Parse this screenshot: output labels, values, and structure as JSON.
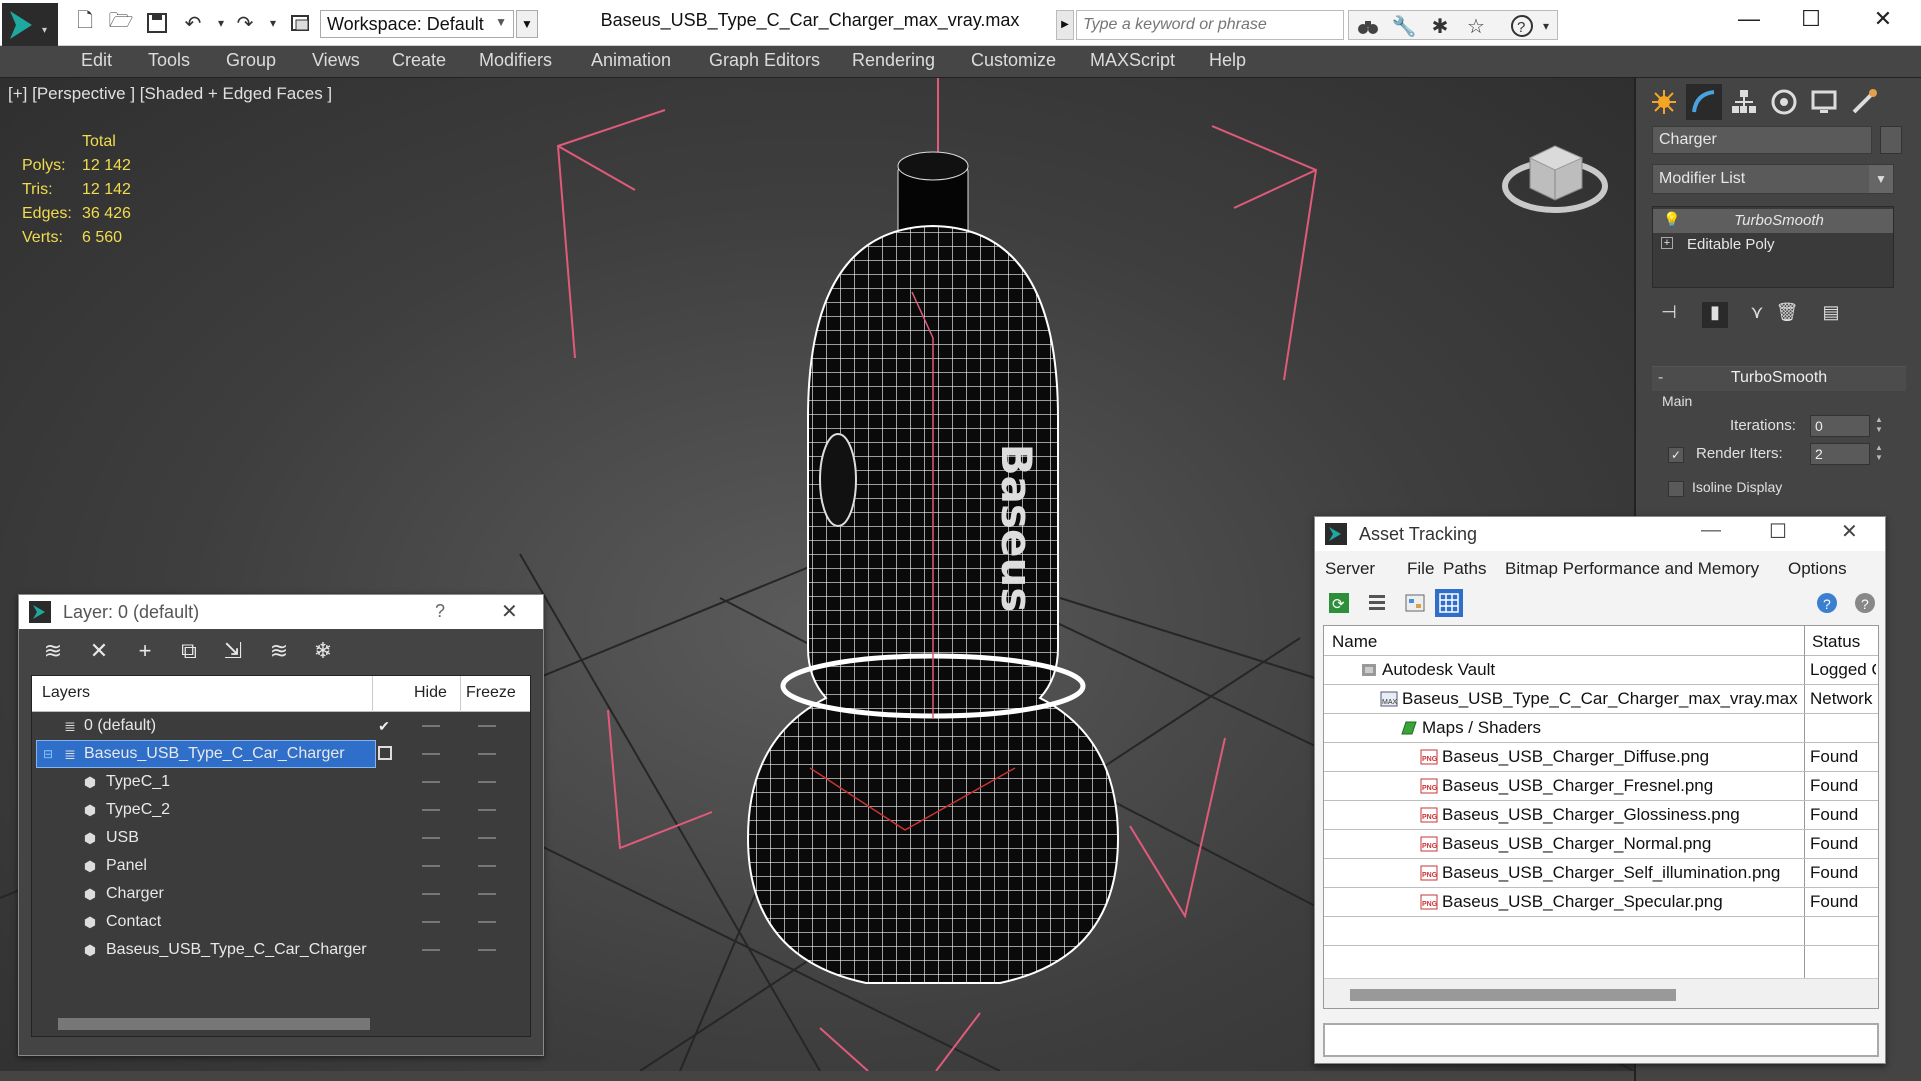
{
  "titlebar": {
    "workspace_label": "Workspace: Default",
    "file_title": "Baseus_USB_Type_C_Car_Charger_max_vray.max",
    "search_placeholder": "Type a keyword or phrase",
    "quick_access_icons": [
      "new-file-icon",
      "open-file-icon",
      "save-icon",
      "undo-icon",
      "redo-icon",
      "project-icon"
    ],
    "search_tool_icons": [
      "binoculars-icon",
      "wrench-icon",
      "star-network-icon",
      "favorite-star-icon",
      "help-icon"
    ],
    "window_controls": [
      "minimize",
      "maximize",
      "close"
    ]
  },
  "menubar": {
    "items": [
      "Edit",
      "Tools",
      "Group",
      "Views",
      "Create",
      "Modifiers",
      "Animation",
      "Graph Editors",
      "Rendering",
      "Customize",
      "MAXScript",
      "Help"
    ]
  },
  "viewport": {
    "label": "[+] [Perspective ] [Shaded + Edged Faces ]",
    "stats_header": "Total",
    "stats": [
      {
        "label": "Polys:",
        "value": "12 142"
      },
      {
        "label": "Tris:",
        "value": "12 142"
      },
      {
        "label": "Edges:",
        "value": "36 426"
      },
      {
        "label": "Verts:",
        "value": "6 560"
      }
    ],
    "model_text": "Baseus",
    "colors": {
      "stats": "#f0dc4e",
      "wire": "#ffffff",
      "bbox": "#e05a7a"
    }
  },
  "command_panel": {
    "tab_icons": [
      "create-icon",
      "modify-icon",
      "hierarchy-icon",
      "motion-icon",
      "display-icon",
      "utilities-icon"
    ],
    "object_name": "Charger",
    "modifier_list": "Modifier List",
    "stack": [
      "TurboSmooth",
      "Editable Poly"
    ],
    "rollout_title": "TurboSmooth",
    "group_main": "Main",
    "iterations_label": "Iterations:",
    "iterations_value": "0",
    "render_iters_label": "Render Iters:",
    "render_iters_value": "2",
    "isoline_label": "Isoline Display",
    "render_iters_checked": true,
    "isoline_checked": false
  },
  "layer_dialog": {
    "title": "Layer: 0 (default)",
    "help": "?",
    "toolbar_icons": [
      "new-layer-icon",
      "delete-icon",
      "add-icon",
      "select-objects-icon",
      "highlight-icon",
      "hide-all-icon",
      "freeze-all-icon"
    ],
    "columns": {
      "layers": "Layers",
      "hide": "Hide",
      "freeze": "Freeze"
    },
    "rows": [
      {
        "name": "0 (default)",
        "level": 0,
        "type": "layer"
      },
      {
        "name": "Baseus_USB_Type_C_Car_Charger",
        "level": 0,
        "type": "layer",
        "selected": true
      },
      {
        "name": "TypeC_1",
        "level": 1,
        "type": "object"
      },
      {
        "name": "TypeC_2",
        "level": 1,
        "type": "object"
      },
      {
        "name": "USB",
        "level": 1,
        "type": "object"
      },
      {
        "name": "Panel",
        "level": 1,
        "type": "object"
      },
      {
        "name": "Charger",
        "level": 1,
        "type": "object"
      },
      {
        "name": "Contact",
        "level": 1,
        "type": "object"
      },
      {
        "name": "Baseus_USB_Type_C_Car_Charger",
        "level": 1,
        "type": "object"
      }
    ]
  },
  "asset_dialog": {
    "title": "Asset Tracking",
    "menu": [
      "Server",
      "File",
      "Paths",
      "Bitmap Performance and Memory",
      "Options"
    ],
    "toolbar_icons": [
      "refresh-icon",
      "list-view-icon",
      "tree-view-icon",
      "table-view-icon",
      "help-icon",
      "help-context-icon"
    ],
    "columns": {
      "name": "Name",
      "status": "Status"
    },
    "rows": [
      {
        "name": "Autodesk Vault",
        "status": "Logged Out",
        "level": 1,
        "icon": "vault-icon"
      },
      {
        "name": "Baseus_USB_Type_C_Car_Charger_max_vray.max",
        "status": "Network",
        "level": 2,
        "icon": "max-file-icon"
      },
      {
        "name": "Maps / Shaders",
        "status": "",
        "level": 3,
        "icon": "maps-icon"
      },
      {
        "name": "Baseus_USB_Charger_Diffuse.png",
        "status": "Found",
        "level": 4,
        "icon": "png-icon"
      },
      {
        "name": "Baseus_USB_Charger_Fresnel.png",
        "status": "Found",
        "level": 4,
        "icon": "png-icon"
      },
      {
        "name": "Baseus_USB_Charger_Glossiness.png",
        "status": "Found",
        "level": 4,
        "icon": "png-icon"
      },
      {
        "name": "Baseus_USB_Charger_Normal.png",
        "status": "Found",
        "level": 4,
        "icon": "png-icon"
      },
      {
        "name": "Baseus_USB_Charger_Self_illumination.png",
        "status": "Found",
        "level": 4,
        "icon": "png-icon"
      },
      {
        "name": "Baseus_USB_Charger_Specular.png",
        "status": "Found",
        "level": 4,
        "icon": "png-icon"
      }
    ]
  }
}
